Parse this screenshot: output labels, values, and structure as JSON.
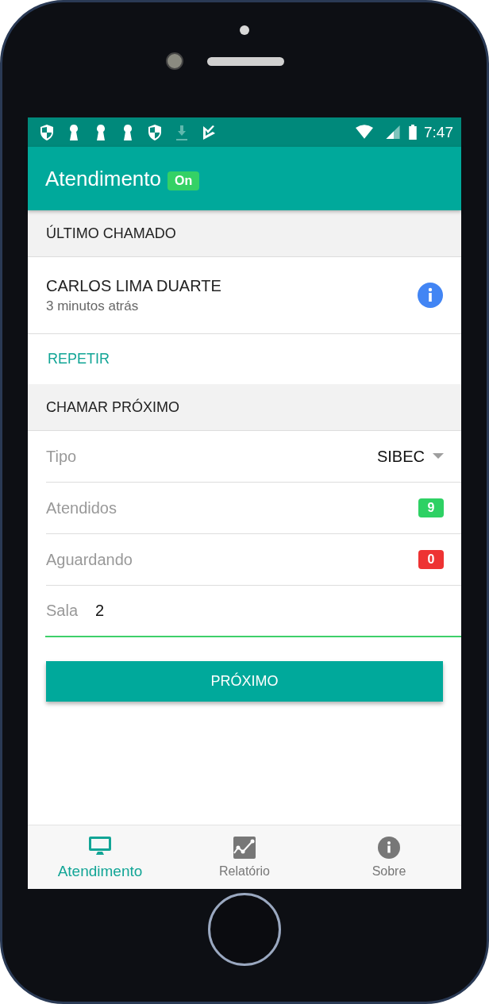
{
  "status_bar": {
    "time": "7:47"
  },
  "app_bar": {
    "title": "Atendimento",
    "badge": "On"
  },
  "last_call": {
    "header": "ÚLTIMO CHAMADO",
    "name": "CARLOS LIMA DUARTE",
    "time": "3 minutos atrás",
    "action": "REPETIR"
  },
  "next_call": {
    "header": "CHAMAR PRÓXIMO",
    "rows": [
      {
        "kind": "select",
        "label": "Tipo",
        "value": "SIBEC"
      },
      {
        "kind": "count",
        "label": "Atendidos",
        "value": "9",
        "color": "#2ed164"
      },
      {
        "kind": "count",
        "label": "Aguardando",
        "value": "0",
        "color": "#ee3333"
      },
      {
        "kind": "input",
        "label": "Sala",
        "value": "2"
      }
    ],
    "button": "PRÓXIMO"
  },
  "bottom_nav": [
    {
      "label": "Atendimento",
      "selected": true,
      "kind": "monitor"
    },
    {
      "label": "Relatório",
      "selected": false,
      "kind": "chart"
    },
    {
      "label": "Sobre",
      "selected": false,
      "kind": "info"
    }
  ]
}
